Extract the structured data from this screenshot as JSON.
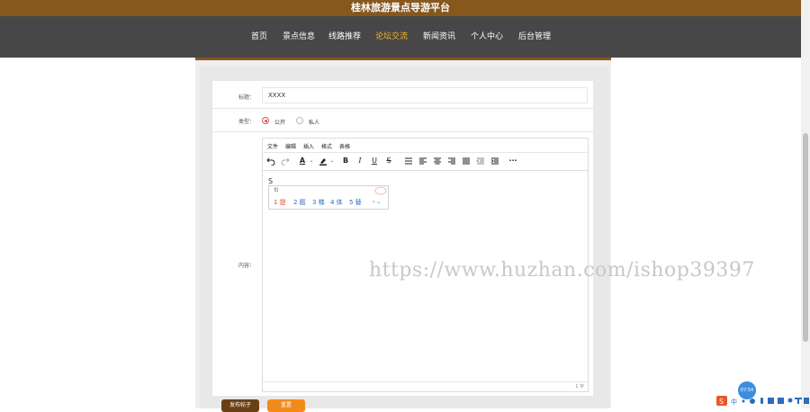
{
  "site_title": "桂林旅游景点导游平台",
  "nav": [
    "首页",
    "景点信息",
    "线路推荐",
    "论坛交流",
    "新闻资讯",
    "个人中心",
    "后台管理"
  ],
  "nav_active": "论坛交流",
  "form": {
    "title_label": "标题：",
    "title_value": "XXXX",
    "type_label": "类型：",
    "type_options": [
      "公开",
      "私人"
    ],
    "type_selected": "公开",
    "content_label": "内容："
  },
  "editor": {
    "menus": [
      "文件",
      "编辑",
      "插入",
      "格式",
      "表格"
    ],
    "typed_text": "S",
    "word_count": "1 字"
  },
  "ime": {
    "input": "ti",
    "candidates": [
      "1 提",
      "2 题",
      "3 梯",
      "4 体",
      "5 替"
    ],
    "nav": "› ⌄"
  },
  "buttons": {
    "publish": "发布帖子",
    "reset": "重置"
  },
  "watermark": "https://www.huzhan.com/ishop39397",
  "tray": {
    "clock": "07:54"
  },
  "colors": {
    "brand_brown": "#86581e",
    "nav_bg": "#474747",
    "active_nav": "#f2b531",
    "radio_red": "#d9534f",
    "reset_orange": "#f28a1a"
  }
}
